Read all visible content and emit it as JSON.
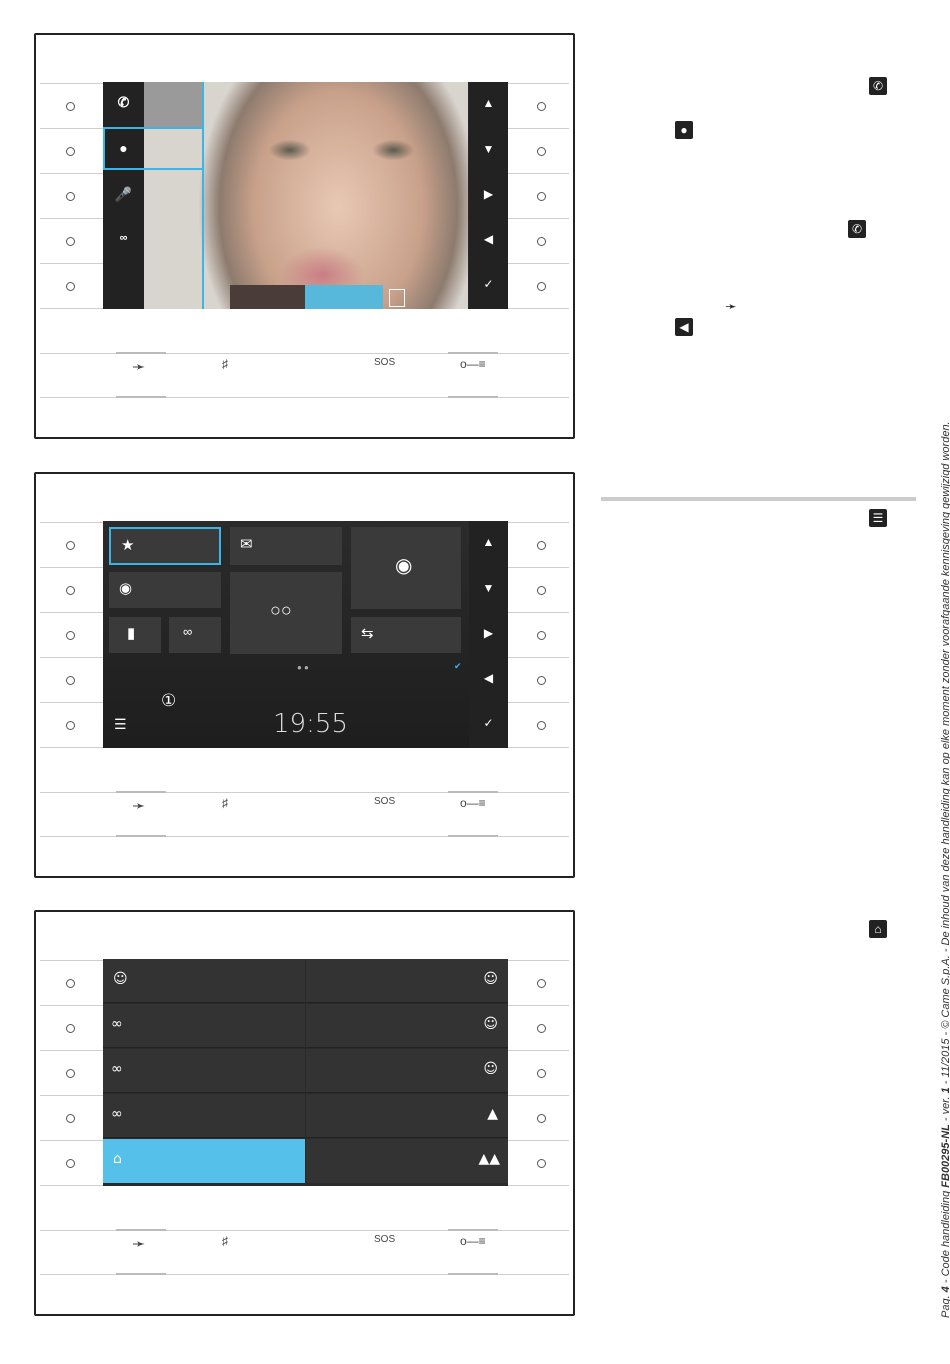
{
  "footer": {
    "prefix": "Pag. ",
    "page": "4",
    "mid": " - Code handleiding ",
    "code": "FB00295-NL",
    "ver_pre": " - ver. ",
    "ver": "1",
    "rest": " - 11/2015 - © Came S.p.A. - De inhoud van deze handleiding kan op elke moment zonder voorafgaande kennisgeving gewijzigd worden."
  },
  "device2": {
    "clock": "19:55"
  },
  "icons": {
    "right_column": [
      "call-divert-icon",
      "circle-icon",
      "call-divert-icon",
      "phone-handset-icon",
      "back-icon",
      "list-icon",
      "home-icon"
    ],
    "bottom_bar": [
      "handset-icon",
      "bell-off-icon",
      "sos-icon",
      "key-icon"
    ]
  },
  "colors": {
    "accent": "#3cb5e6",
    "screen_bg": "#2a2a2a"
  }
}
